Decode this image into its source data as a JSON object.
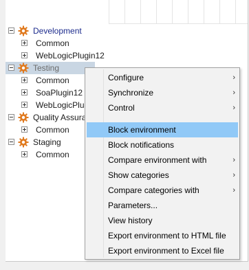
{
  "tree": {
    "development": {
      "label": "Development",
      "children": [
        "Common",
        "WebLogicPlugin12"
      ]
    },
    "testing": {
      "label": "Testing",
      "children": [
        "Common",
        "SoaPlugin12",
        "WebLogicPlu"
      ]
    },
    "quality": {
      "label": "Quality Assura",
      "children": [
        "Common"
      ]
    },
    "staging": {
      "label": "Staging",
      "children": [
        "Common"
      ]
    }
  },
  "context_menu": {
    "items": [
      {
        "label": "Configure",
        "submenu": true
      },
      {
        "label": "Synchronize",
        "submenu": true
      },
      {
        "label": "Control",
        "submenu": true
      },
      {
        "label": "Block environment",
        "submenu": false,
        "highlighted": true
      },
      {
        "label": "Block notifications",
        "submenu": false
      },
      {
        "label": "Compare environment with",
        "submenu": true
      },
      {
        "label": "Show categories",
        "submenu": true
      },
      {
        "label": "Compare categories with",
        "submenu": true
      },
      {
        "label": "Parameters...",
        "submenu": false
      },
      {
        "label": "View history",
        "submenu": false
      },
      {
        "label": "Export environment to HTML file",
        "submenu": false
      },
      {
        "label": "Export environment to Excel file",
        "submenu": false
      }
    ],
    "submenu_arrow": "›"
  },
  "colors": {
    "environment_label": "#1b2a8c",
    "selection": "#c9d6e3",
    "menu_hover": "#91c9f7",
    "gear": "#e07a1f"
  }
}
